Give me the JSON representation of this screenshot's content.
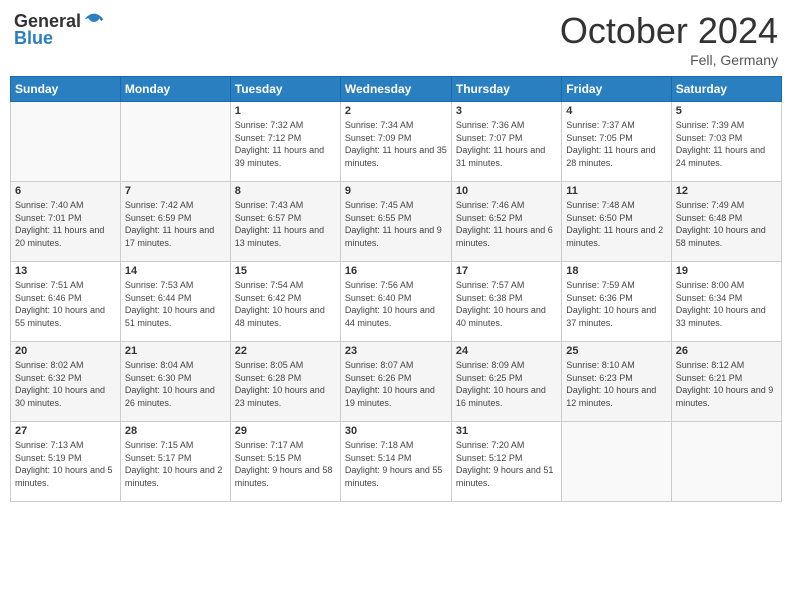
{
  "header": {
    "logo_general": "General",
    "logo_blue": "Blue",
    "month_title": "October 2024",
    "location": "Fell, Germany"
  },
  "days_of_week": [
    "Sunday",
    "Monday",
    "Tuesday",
    "Wednesday",
    "Thursday",
    "Friday",
    "Saturday"
  ],
  "weeks": [
    [
      {
        "day": "",
        "info": ""
      },
      {
        "day": "",
        "info": ""
      },
      {
        "day": "1",
        "info": "Sunrise: 7:32 AM\nSunset: 7:12 PM\nDaylight: 11 hours and 39 minutes."
      },
      {
        "day": "2",
        "info": "Sunrise: 7:34 AM\nSunset: 7:09 PM\nDaylight: 11 hours and 35 minutes."
      },
      {
        "day": "3",
        "info": "Sunrise: 7:36 AM\nSunset: 7:07 PM\nDaylight: 11 hours and 31 minutes."
      },
      {
        "day": "4",
        "info": "Sunrise: 7:37 AM\nSunset: 7:05 PM\nDaylight: 11 hours and 28 minutes."
      },
      {
        "day": "5",
        "info": "Sunrise: 7:39 AM\nSunset: 7:03 PM\nDaylight: 11 hours and 24 minutes."
      }
    ],
    [
      {
        "day": "6",
        "info": "Sunrise: 7:40 AM\nSunset: 7:01 PM\nDaylight: 11 hours and 20 minutes."
      },
      {
        "day": "7",
        "info": "Sunrise: 7:42 AM\nSunset: 6:59 PM\nDaylight: 11 hours and 17 minutes."
      },
      {
        "day": "8",
        "info": "Sunrise: 7:43 AM\nSunset: 6:57 PM\nDaylight: 11 hours and 13 minutes."
      },
      {
        "day": "9",
        "info": "Sunrise: 7:45 AM\nSunset: 6:55 PM\nDaylight: 11 hours and 9 minutes."
      },
      {
        "day": "10",
        "info": "Sunrise: 7:46 AM\nSunset: 6:52 PM\nDaylight: 11 hours and 6 minutes."
      },
      {
        "day": "11",
        "info": "Sunrise: 7:48 AM\nSunset: 6:50 PM\nDaylight: 11 hours and 2 minutes."
      },
      {
        "day": "12",
        "info": "Sunrise: 7:49 AM\nSunset: 6:48 PM\nDaylight: 10 hours and 58 minutes."
      }
    ],
    [
      {
        "day": "13",
        "info": "Sunrise: 7:51 AM\nSunset: 6:46 PM\nDaylight: 10 hours and 55 minutes."
      },
      {
        "day": "14",
        "info": "Sunrise: 7:53 AM\nSunset: 6:44 PM\nDaylight: 10 hours and 51 minutes."
      },
      {
        "day": "15",
        "info": "Sunrise: 7:54 AM\nSunset: 6:42 PM\nDaylight: 10 hours and 48 minutes."
      },
      {
        "day": "16",
        "info": "Sunrise: 7:56 AM\nSunset: 6:40 PM\nDaylight: 10 hours and 44 minutes."
      },
      {
        "day": "17",
        "info": "Sunrise: 7:57 AM\nSunset: 6:38 PM\nDaylight: 10 hours and 40 minutes."
      },
      {
        "day": "18",
        "info": "Sunrise: 7:59 AM\nSunset: 6:36 PM\nDaylight: 10 hours and 37 minutes."
      },
      {
        "day": "19",
        "info": "Sunrise: 8:00 AM\nSunset: 6:34 PM\nDaylight: 10 hours and 33 minutes."
      }
    ],
    [
      {
        "day": "20",
        "info": "Sunrise: 8:02 AM\nSunset: 6:32 PM\nDaylight: 10 hours and 30 minutes."
      },
      {
        "day": "21",
        "info": "Sunrise: 8:04 AM\nSunset: 6:30 PM\nDaylight: 10 hours and 26 minutes."
      },
      {
        "day": "22",
        "info": "Sunrise: 8:05 AM\nSunset: 6:28 PM\nDaylight: 10 hours and 23 minutes."
      },
      {
        "day": "23",
        "info": "Sunrise: 8:07 AM\nSunset: 6:26 PM\nDaylight: 10 hours and 19 minutes."
      },
      {
        "day": "24",
        "info": "Sunrise: 8:09 AM\nSunset: 6:25 PM\nDaylight: 10 hours and 16 minutes."
      },
      {
        "day": "25",
        "info": "Sunrise: 8:10 AM\nSunset: 6:23 PM\nDaylight: 10 hours and 12 minutes."
      },
      {
        "day": "26",
        "info": "Sunrise: 8:12 AM\nSunset: 6:21 PM\nDaylight: 10 hours and 9 minutes."
      }
    ],
    [
      {
        "day": "27",
        "info": "Sunrise: 7:13 AM\nSunset: 5:19 PM\nDaylight: 10 hours and 5 minutes."
      },
      {
        "day": "28",
        "info": "Sunrise: 7:15 AM\nSunset: 5:17 PM\nDaylight: 10 hours and 2 minutes."
      },
      {
        "day": "29",
        "info": "Sunrise: 7:17 AM\nSunset: 5:15 PM\nDaylight: 9 hours and 58 minutes."
      },
      {
        "day": "30",
        "info": "Sunrise: 7:18 AM\nSunset: 5:14 PM\nDaylight: 9 hours and 55 minutes."
      },
      {
        "day": "31",
        "info": "Sunrise: 7:20 AM\nSunset: 5:12 PM\nDaylight: 9 hours and 51 minutes."
      },
      {
        "day": "",
        "info": ""
      },
      {
        "day": "",
        "info": ""
      }
    ]
  ]
}
